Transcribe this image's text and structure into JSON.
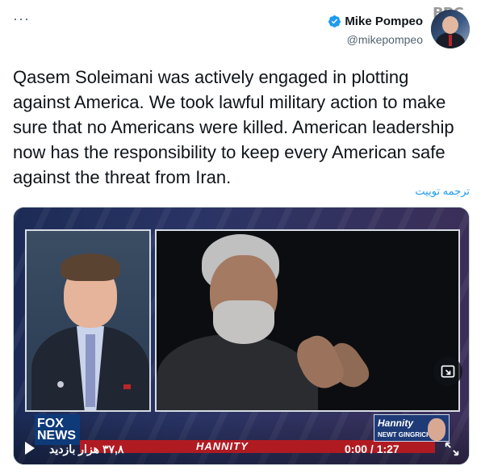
{
  "more_label": "···",
  "author": {
    "display_name": "Mike Pompeo",
    "handle": "@mikepompeo"
  },
  "watermark": "BBC",
  "tweet": {
    "text": "Qasem Soleimani was actively engaged in plotting against America. We took lawful military action to make sure that no Americans were killed. American leadership now has the responsibility to keep every American safe against the threat from Iran.",
    "translate_label": "ترجمه توییت"
  },
  "video": {
    "channel_logo": "FOX NEWS",
    "show_name": "HANNITY",
    "inset_title": "Hannity",
    "inset_sub": "NEWT GINGRICH",
    "views": "۳۷,۸ هزار بازدید",
    "time": "0:00 / 1:27"
  },
  "colors": {
    "accent": "#1d9bf0",
    "text": "#0f1419",
    "muted": "#536471"
  },
  "icons": {
    "verified": "verified-badge-icon",
    "play": "play-icon",
    "expand": "picture-in-picture-icon",
    "fullscreen": "fullscreen-icon"
  }
}
